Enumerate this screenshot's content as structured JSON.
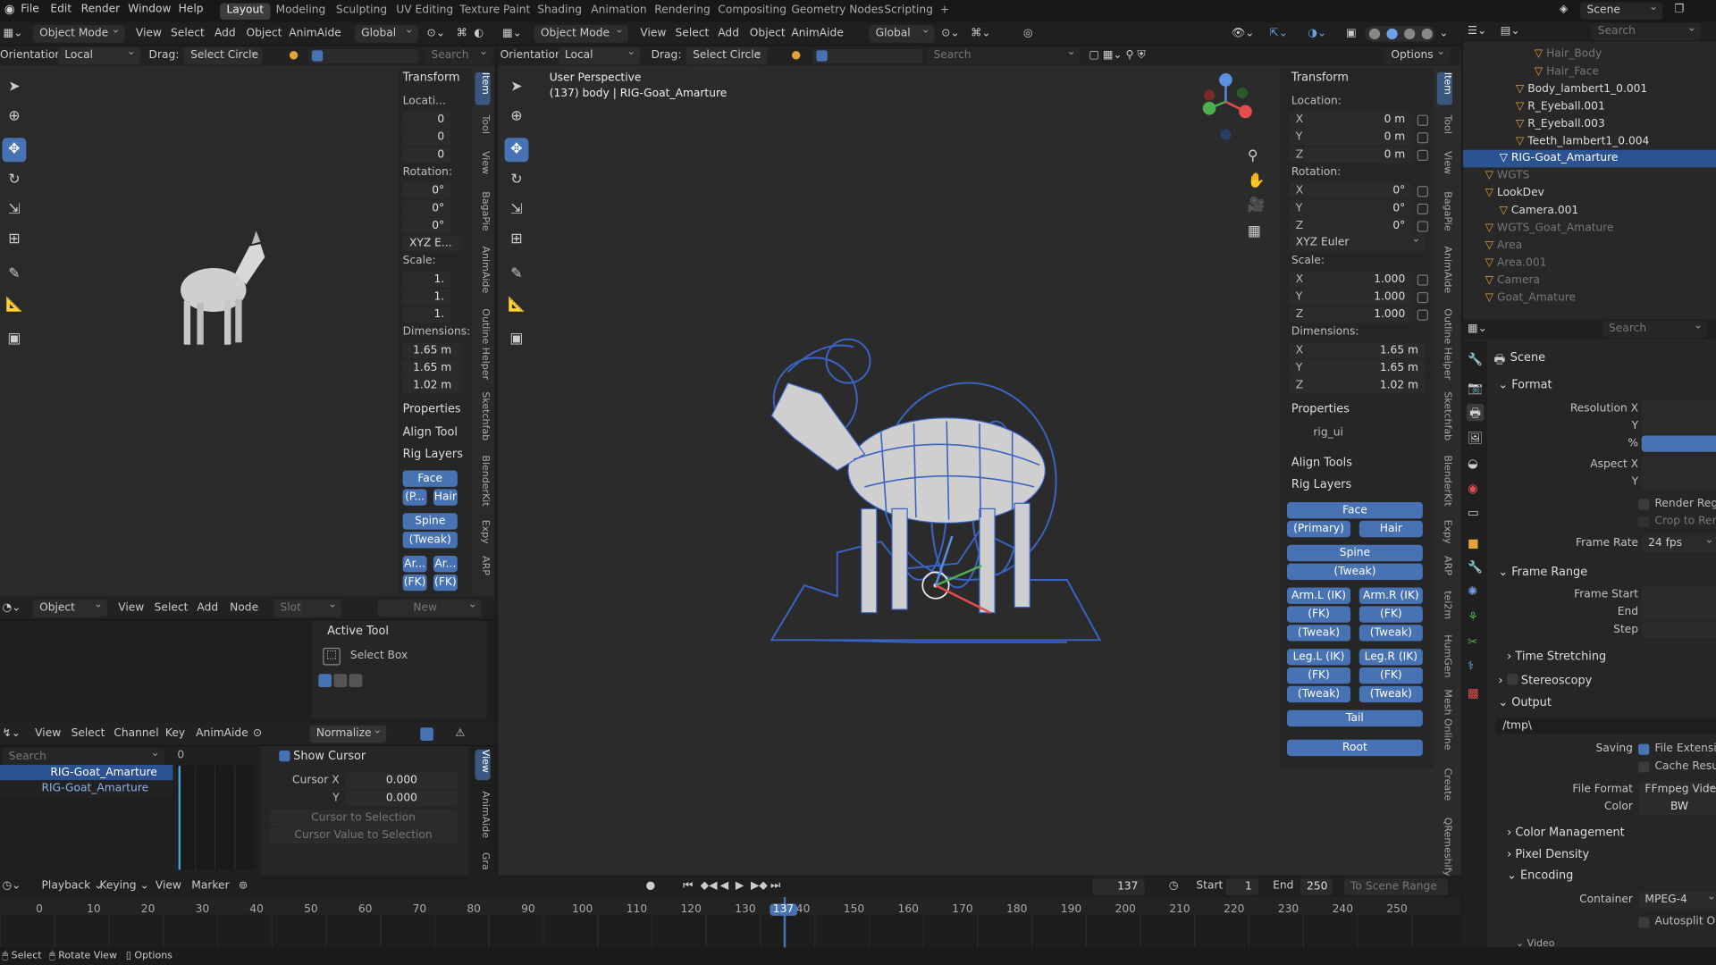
{
  "menu": [
    "File",
    "Edit",
    "Render",
    "Window",
    "Help"
  ],
  "workspaces": [
    {
      "label": "Layout",
      "active": true
    },
    {
      "label": "Modeling"
    },
    {
      "label": "Sculpting"
    },
    {
      "label": "UV Editing"
    },
    {
      "label": "Texture Paint"
    },
    {
      "label": "Shading"
    },
    {
      "label": "Animation"
    },
    {
      "label": "Rendering"
    },
    {
      "label": "Compositing"
    },
    {
      "label": "Geometry Nodes"
    },
    {
      "label": "Scripting"
    },
    {
      "label": "+"
    }
  ],
  "scene_selector": "Scene",
  "top_search_placeholder": "Search",
  "left_viewport": {
    "mode": "Object Mode",
    "menus": [
      "View",
      "Select",
      "Add",
      "Object",
      "AnimAide"
    ],
    "transform_orientation": "Global",
    "orientation_label": "Orientation:",
    "orientation_value": "Local",
    "drag_label": "Drag:",
    "drag_value": "Select Circle",
    "search_placeholder": "Search",
    "npanel": {
      "transform_title": "Transform",
      "location_label": "Locati...",
      "location": [
        "0",
        "0",
        "0"
      ],
      "rotation_label": "Rotation:",
      "rotation": [
        "0°",
        "0°",
        "0°"
      ],
      "rotation_mode": "XYZ E...",
      "scale_label": "Scale:",
      "scale": [
        "1.",
        "1.",
        "1."
      ],
      "dimensions_label": "Dimensions:",
      "dimensions": [
        "1.65 m",
        "1.65 m",
        "1.02 m"
      ],
      "properties": "Properties",
      "align_tool": "Align Tool",
      "rig_layers": "Rig Layers",
      "buttons": {
        "face": "Face",
        "p": "(P...",
        "hair": "Hair",
        "spine": "Spine",
        "tweak": "(Tweak)",
        "ar1": "Ar...",
        "ar2": "Ar...",
        "fk1": "(FK)",
        "fk2": "(FK)"
      }
    },
    "vtabs": [
      "Item",
      "Tool",
      "View",
      "BagaPie",
      "AnimAide",
      "Outline Helper",
      "Sketchfab",
      "BlenderKit",
      "Expy",
      "ARP"
    ]
  },
  "node_editor": {
    "type": "Object",
    "menus": [
      "View",
      "Select",
      "Add",
      "Node"
    ],
    "slot": "Slot",
    "new": "New",
    "active_tool_title": "Active Tool",
    "active_tool": "Select Box"
  },
  "graph_editor": {
    "menus": [
      "View",
      "Select",
      "Channel",
      "Key",
      "AnimAide"
    ],
    "normalize": "Normalize",
    "search_placeholder": "Search",
    "channels": [
      "RIG-Goat_Amarture",
      "RIG-Goat_Amarture"
    ],
    "frame_zero": "0",
    "show_cursor": "Show Cursor",
    "cursor_x_label": "Cursor X",
    "cursor_x": "0.000",
    "cursor_y_label": "Y",
    "cursor_y": "0.000",
    "cursor_to_selection": "Cursor to Selection",
    "cursor_value_to_selection": "Cursor Value to Selection",
    "vtabs": [
      "View",
      "AnimAide",
      "Gra"
    ]
  },
  "main_viewport": {
    "mode": "Object Mode",
    "menus": [
      "View",
      "Select",
      "Add",
      "Object",
      "AnimAide"
    ],
    "transform_orientation": "Global",
    "orientation_label": "Orientation:",
    "orientation_value": "Local",
    "drag_label": "Drag:",
    "drag_value": "Select Circle",
    "search_placeholder": "Search",
    "options": "Options",
    "overlay_title": "User Perspective",
    "overlay_subtitle": "(137) body | RIG-Goat_Amarture",
    "npanel": {
      "transform_title": "Transform",
      "location_label": "Location:",
      "location": [
        {
          "axis": "X",
          "value": "0 m"
        },
        {
          "axis": "Y",
          "value": "0 m"
        },
        {
          "axis": "Z",
          "value": "0 m"
        }
      ],
      "rotation_label": "Rotation:",
      "rotation": [
        {
          "axis": "X",
          "value": "0°"
        },
        {
          "axis": "Y",
          "value": "0°"
        },
        {
          "axis": "Z",
          "value": "0°"
        }
      ],
      "rotation_mode": "XYZ Euler",
      "scale_label": "Scale:",
      "scale": [
        {
          "axis": "X",
          "value": "1.000"
        },
        {
          "axis": "Y",
          "value": "1.000"
        },
        {
          "axis": "Z",
          "value": "1.000"
        }
      ],
      "dimensions_label": "Dimensions:",
      "dimensions": [
        {
          "axis": "X",
          "value": "1.65 m"
        },
        {
          "axis": "Y",
          "value": "1.65 m"
        },
        {
          "axis": "Z",
          "value": "1.02 m"
        }
      ],
      "properties": "Properties",
      "rig_ui": "rig_ui",
      "align_tools": "Align Tools",
      "rig_layers": "Rig Layers",
      "buttons": {
        "face": "Face",
        "primary": "(Primary)",
        "hair": "Hair",
        "spine": "Spine",
        "tweak": "(Tweak)",
        "arm_l_ik": "Arm.L (IK)",
        "arm_r_ik": "Arm.R (IK)",
        "arm_l_fk": "(FK)",
        "arm_r_fk": "(FK)",
        "arm_l_tweak": "(Tweak)",
        "arm_r_tweak": "(Tweak)",
        "leg_l_ik": "Leg.L (IK)",
        "leg_r_ik": "Leg.R (IK)",
        "leg_l_fk": "(FK)",
        "leg_r_fk": "(FK)",
        "leg_l_tweak": "(Tweak)",
        "leg_r_tweak": "(Tweak)",
        "tail": "Tail",
        "root": "Root"
      }
    },
    "vtabs": [
      "Item",
      "Tool",
      "View",
      "BagaPie",
      "AnimAide",
      "Outline Helper",
      "Sketchfab",
      "BlenderKit",
      "Expy",
      "ARP",
      "tei2m",
      "HumGen",
      "Mesh Online",
      "Create",
      "QRemeshify"
    ]
  },
  "outliner": {
    "search_placeholder": "Search",
    "rows": [
      {
        "label": "Hair_Body",
        "dim": true
      },
      {
        "label": "Hair_Face",
        "dim": true
      },
      {
        "label": "Body_lambert1_0.001"
      },
      {
        "label": "R_Eyeball.001"
      },
      {
        "label": "R_Eyeball.003"
      },
      {
        "label": "Teeth_lambert1_0.004"
      },
      {
        "label": "RIG-Goat_Amarture",
        "selected": true
      },
      {
        "label": "WGTS",
        "dim": true
      },
      {
        "label": "LookDev"
      },
      {
        "label": "Camera.001"
      },
      {
        "label": "WGTS_Goat_Amature",
        "dim": true
      },
      {
        "label": "Area",
        "dim": true
      },
      {
        "label": "Area.001",
        "dim": true
      },
      {
        "label": "Camera",
        "dim": true
      },
      {
        "label": "Goat_Amature",
        "dim": true
      }
    ]
  },
  "properties": {
    "search_placeholder": "Search",
    "scene": "Scene",
    "format": "Format",
    "resolution_x": "Resolution X",
    "y": "Y",
    "percent": "%",
    "aspect_x": "Aspect X",
    "aspect_y": "Y",
    "render_region": "Render Region",
    "crop_to_render": "Crop to Render",
    "frame_rate_label": "Frame Rate",
    "frame_rate": "24 fps",
    "frame_range": "Frame Range",
    "frame_start": "Frame Start",
    "end": "End",
    "step": "Step",
    "time_stretching": "Time Stretching",
    "stereoscopy": "Stereoscopy",
    "output": "Output",
    "output_path": "/tmp\\",
    "saving": "Saving",
    "file_extensions": "File Extensions",
    "cache_result": "Cache Result",
    "file_format_label": "File Format",
    "file_format": "FFmpeg Vide",
    "color_label": "Color",
    "color": "BW",
    "color_management": "Color Management",
    "pixel_density": "Pixel Density",
    "encoding": "Encoding",
    "container_label": "Container",
    "container": "MPEG-4",
    "autosplit": "Autosplit Outpu",
    "video": "Video"
  },
  "timeline": {
    "menus": [
      "Playback",
      "Keying",
      "View",
      "Marker"
    ],
    "current_frame": "137",
    "start_label": "Start",
    "start": "1",
    "end_label": "End",
    "end": "250",
    "to_scene_range": "To Scene Range",
    "ruler": [
      "0",
      "10",
      "20",
      "30",
      "40",
      "50",
      "60",
      "70",
      "80",
      "90",
      "100",
      "110",
      "120",
      "130",
      "137",
      "140",
      "150",
      "160",
      "170",
      "180",
      "190",
      "200",
      "210",
      "220",
      "230",
      "240",
      "250"
    ]
  },
  "statusbar": {
    "select": "Select",
    "rotate_view": "Rotate View",
    "options": "Options"
  },
  "colors": {
    "accent": "#4772b3",
    "selected_row": "#2b5291",
    "bg": "#1d1d1d",
    "panel": "#262626"
  }
}
